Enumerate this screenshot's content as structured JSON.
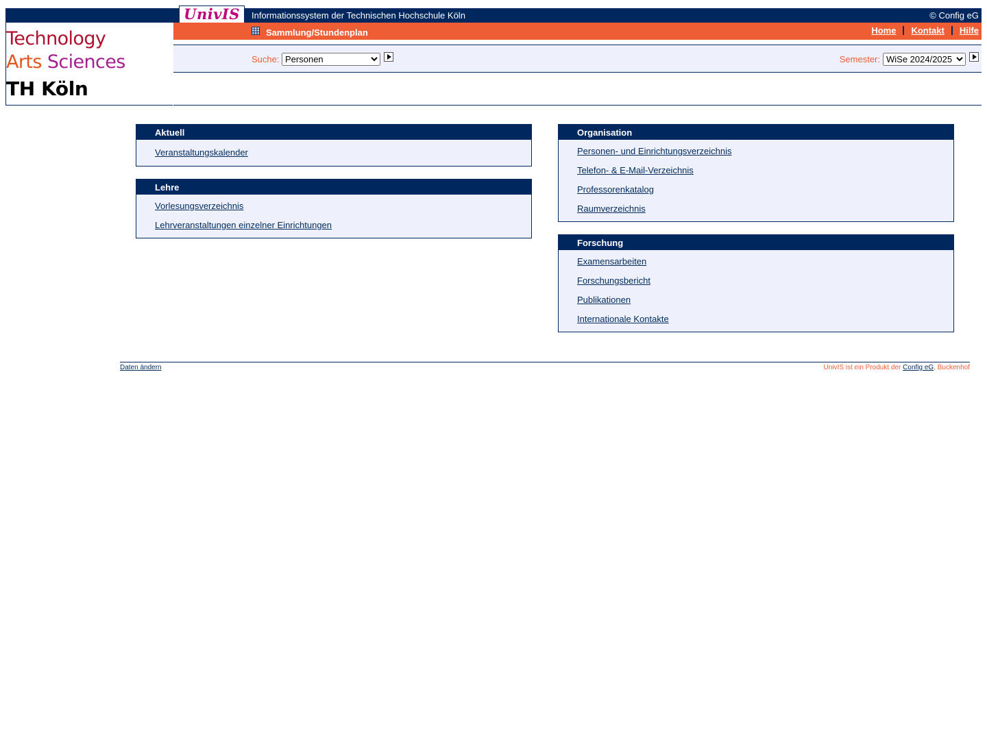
{
  "header": {
    "univis_logo": "UnivIS",
    "site_title": "Informationssystem der Technischen Hochschule Köln",
    "copyright": "© Config eG",
    "logo": {
      "line1": "Technology",
      "line2_word1": "Arts",
      "line2_word2": "Sciences",
      "line3": "TH Köln"
    },
    "plan_link": "Sammlung/Stundenplan",
    "nav": {
      "home": "Home",
      "kontakt": "Kontakt",
      "hilfe": "Hilfe"
    },
    "search": {
      "label": "Suche:",
      "selected": "Personen"
    },
    "semester": {
      "label": "Semester:",
      "selected": "WiSe 2024/2025"
    }
  },
  "boxes": {
    "aktuell": {
      "title": "Aktuell",
      "links": [
        "Veranstaltungskalender"
      ]
    },
    "lehre": {
      "title": "Lehre",
      "links": [
        "Vorlesungsverzeichnis",
        "Lehrveranstaltungen einzelner Einrichtungen"
      ]
    },
    "organisation": {
      "title": "Organisation",
      "links": [
        "Personen- und Einrichtungsverzeichnis",
        "Telefon- & E-Mail-Verzeichnis",
        "Professorenkatalog",
        "Raumverzeichnis"
      ]
    },
    "forschung": {
      "title": "Forschung",
      "links": [
        "Examensarbeiten",
        "Forschungsbericht",
        "Publikationen",
        "Internationale Kontakte"
      ]
    }
  },
  "footer": {
    "left_link": "Daten ändern",
    "right_prefix": "UnivIS ist ein Produkt der",
    "right_link": "Config eG",
    "right_suffix": ", Buckenhof"
  },
  "colors": {
    "navy": "#00275e",
    "orange": "#ef5d34",
    "panel": "#eef0fb"
  },
  "icons": {
    "plan": "grid-table-icon",
    "go": "play-arrow-icon"
  }
}
